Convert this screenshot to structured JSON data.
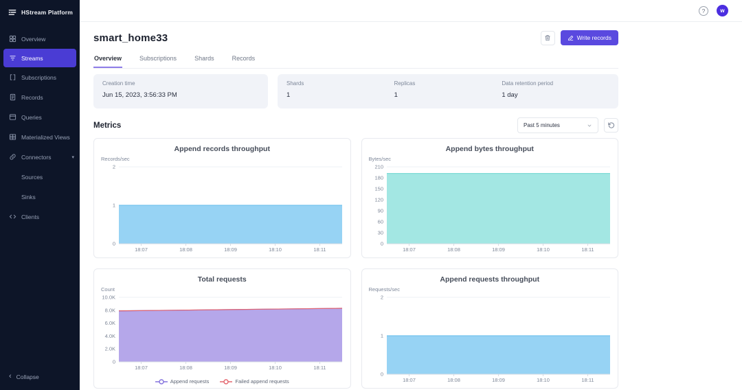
{
  "app": {
    "name": "HStream Platform"
  },
  "topbar": {
    "help_label": "?",
    "avatar_initial": "w"
  },
  "sidebar": {
    "items": [
      {
        "label": "Overview"
      },
      {
        "label": "Streams",
        "active": true
      },
      {
        "label": "Subscriptions"
      },
      {
        "label": "Records"
      },
      {
        "label": "Queries"
      },
      {
        "label": "Materialized Views"
      },
      {
        "label": "Connectors",
        "expandable": true
      },
      {
        "label": "Sources",
        "child": true
      },
      {
        "label": "Sinks",
        "child": true
      },
      {
        "label": "Clients"
      }
    ],
    "collapse_label": "Collapse"
  },
  "page": {
    "title": "smart_home33",
    "write_button": "Write records",
    "tabs": [
      {
        "label": "Overview",
        "active": true
      },
      {
        "label": "Subscriptions"
      },
      {
        "label": "Shards"
      },
      {
        "label": "Records"
      }
    ],
    "info": {
      "creation_time_label": "Creation time",
      "creation_time_value": "Jun 15, 2023, 3:56:33 PM",
      "shards_label": "Shards",
      "shards_value": "1",
      "replicas_label": "Replicas",
      "replicas_value": "1",
      "retention_label": "Data retention period",
      "retention_value": "1 day"
    },
    "metrics": {
      "heading": "Metrics",
      "range_selector": "Past 5 minutes"
    }
  },
  "colors": {
    "accent": "#5a49df",
    "sidebar_active": "#4a3cd4",
    "chart_blue_fill": "#97d3f4",
    "chart_blue_line": "#74c3ee",
    "chart_cyan_fill": "#a3e7e3",
    "chart_cyan_line": "#7fdcd6",
    "chart_purple_fill": "#b5a7ea",
    "chart_purple_line": "#8472dd",
    "chart_red_line": "#e4666f"
  },
  "chart_data": [
    {
      "type": "area",
      "title": "Append records throughput",
      "ylabel": "Records/sec",
      "xlabel": "",
      "x": [
        "18:07",
        "18:08",
        "18:09",
        "18:10",
        "18:11"
      ],
      "yticks": [
        "0",
        "1",
        "2"
      ],
      "ymax": 2,
      "grid": true,
      "series": [
        {
          "color": "#74c3ee",
          "fill": "#97d3f4",
          "values": [
            1,
            1,
            1,
            1,
            1
          ]
        }
      ]
    },
    {
      "type": "area",
      "title": "Append bytes throughput",
      "ylabel": "Bytes/sec",
      "xlabel": "",
      "x": [
        "18:07",
        "18:08",
        "18:09",
        "18:10",
        "18:11"
      ],
      "yticks": [
        "0",
        "30",
        "60",
        "90",
        "120",
        "150",
        "180",
        "210"
      ],
      "ymax": 210,
      "grid": true,
      "series": [
        {
          "color": "#7fdcd6",
          "fill": "#a3e7e3",
          "values": [
            192,
            192,
            192,
            192,
            192
          ]
        }
      ]
    },
    {
      "type": "area",
      "title": "Total requests",
      "ylabel": "Count",
      "xlabel": "",
      "x": [
        "18:07",
        "18:08",
        "18:09",
        "18:10",
        "18:11"
      ],
      "yticks": [
        "0",
        "2.0K",
        "4.0K",
        "6.0K",
        "8.0K",
        "10.0K"
      ],
      "ymax": 10000,
      "grid": true,
      "legend": true,
      "legend_position": "bottom",
      "series": [
        {
          "name": "Append requests",
          "color": "#8472dd",
          "fill": "#b5a7ea",
          "values": [
            7900,
            8000,
            8100,
            8200,
            8300
          ]
        },
        {
          "name": "Failed append requests",
          "color": "#e4666f",
          "fill": "none",
          "values": [
            7900,
            8000,
            8100,
            8200,
            8300
          ]
        }
      ]
    },
    {
      "type": "area",
      "title": "Append requests throughput",
      "ylabel": "Requests/sec",
      "xlabel": "",
      "x": [
        "18:07",
        "18:08",
        "18:09",
        "18:10",
        "18:11"
      ],
      "yticks": [
        "0",
        "1",
        "2"
      ],
      "ymax": 2,
      "grid": true,
      "series": [
        {
          "color": "#74c3ee",
          "fill": "#97d3f4",
          "values": [
            1,
            1,
            1,
            1,
            1
          ]
        }
      ]
    }
  ]
}
